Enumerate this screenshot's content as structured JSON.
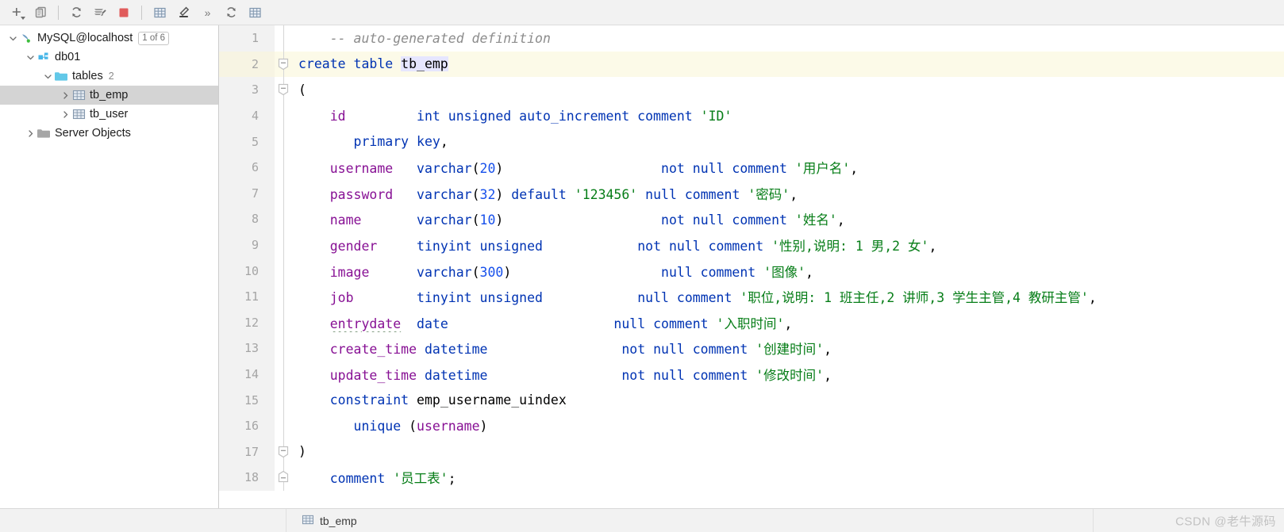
{
  "toolbar": {
    "items": [
      {
        "name": "add-dropdown-icon",
        "title": "New"
      },
      {
        "name": "copy-icon",
        "title": "Duplicate"
      },
      {
        "name": "separator-1",
        "title": ""
      },
      {
        "name": "refresh-icon",
        "title": "Refresh"
      },
      {
        "name": "run-script-icon",
        "title": "Run Script"
      },
      {
        "name": "stop-icon",
        "title": "Stop"
      },
      {
        "name": "separator-2",
        "title": ""
      },
      {
        "name": "table-grid-icon",
        "title": "Data"
      },
      {
        "name": "edit-pencil-icon",
        "title": "Modify"
      },
      {
        "name": "chevron-double-right-icon",
        "title": "More",
        "glyph": "»"
      },
      {
        "name": "refresh-2-icon",
        "title": "Refresh"
      },
      {
        "name": "table-grid-2-icon",
        "title": "Table"
      }
    ]
  },
  "sidebar": {
    "tree": [
      {
        "label": "MySQL@localhost",
        "icon": "dolphin-icon",
        "indent": 0,
        "expanded": true,
        "selected": false,
        "badge": "1 of 6",
        "count": ""
      },
      {
        "label": "db01",
        "icon": "database-icon",
        "indent": 1,
        "expanded": true,
        "selected": false,
        "badge": "",
        "count": ""
      },
      {
        "label": "tables",
        "icon": "folder-cyan-icon",
        "indent": 2,
        "expanded": true,
        "selected": false,
        "badge": "",
        "count": "2"
      },
      {
        "label": "tb_emp",
        "icon": "table-icon",
        "indent": 3,
        "expanded": false,
        "selected": true,
        "badge": "",
        "count": ""
      },
      {
        "label": "tb_user",
        "icon": "table-icon",
        "indent": 3,
        "expanded": false,
        "selected": false,
        "badge": "",
        "count": ""
      },
      {
        "label": "Server Objects",
        "icon": "folder-gray-icon",
        "indent": 1,
        "expanded": false,
        "selected": false,
        "badge": "",
        "count": ""
      }
    ]
  },
  "editor": {
    "highlighted_line": 2,
    "lines": [
      {
        "n": "1",
        "fold": "",
        "tokens": [
          {
            "t": "    ",
            "c": "punct"
          },
          {
            "t": "-- auto-generated definition",
            "c": "cmt"
          }
        ]
      },
      {
        "n": "2",
        "fold": "minus",
        "tokens": [
          {
            "t": "create table ",
            "c": "kw"
          },
          {
            "t": "tb_emp",
            "c": "idhl"
          }
        ]
      },
      {
        "n": "3",
        "fold": "minus",
        "tokens": [
          {
            "t": "(",
            "c": "punct"
          }
        ]
      },
      {
        "n": "4",
        "fold": "",
        "tokens": [
          {
            "t": "    ",
            "c": "punct"
          },
          {
            "t": "id         ",
            "c": "col"
          },
          {
            "t": "int unsigned auto_increment comment ",
            "c": "kw"
          },
          {
            "t": "'ID'",
            "c": "str"
          }
        ]
      },
      {
        "n": "5",
        "fold": "",
        "tokens": [
          {
            "t": "       ",
            "c": "punct"
          },
          {
            "t": "primary key",
            "c": "kw"
          },
          {
            "t": ",",
            "c": "punct"
          }
        ]
      },
      {
        "n": "6",
        "fold": "",
        "tokens": [
          {
            "t": "    ",
            "c": "punct"
          },
          {
            "t": "username",
            "c": "col"
          },
          {
            "t": "   ",
            "c": "punct"
          },
          {
            "t": "varchar",
            "c": "kw"
          },
          {
            "t": "(",
            "c": "punct"
          },
          {
            "t": "20",
            "c": "num"
          },
          {
            "t": ")",
            "c": "punct"
          },
          {
            "t": "                    ",
            "c": "punct"
          },
          {
            "t": "not null comment ",
            "c": "kw"
          },
          {
            "t": "'用户名'",
            "c": "str"
          },
          {
            "t": ",",
            "c": "punct"
          }
        ]
      },
      {
        "n": "7",
        "fold": "",
        "tokens": [
          {
            "t": "    ",
            "c": "punct"
          },
          {
            "t": "password",
            "c": "col"
          },
          {
            "t": "   ",
            "c": "punct"
          },
          {
            "t": "varchar",
            "c": "kw"
          },
          {
            "t": "(",
            "c": "punct"
          },
          {
            "t": "32",
            "c": "num"
          },
          {
            "t": ") ",
            "c": "punct"
          },
          {
            "t": "default ",
            "c": "kw"
          },
          {
            "t": "'123456'",
            "c": "str"
          },
          {
            "t": " null comment ",
            "c": "kw"
          },
          {
            "t": "'密码'",
            "c": "str"
          },
          {
            "t": ",",
            "c": "punct"
          }
        ]
      },
      {
        "n": "8",
        "fold": "",
        "tokens": [
          {
            "t": "    ",
            "c": "punct"
          },
          {
            "t": "name",
            "c": "col"
          },
          {
            "t": "       ",
            "c": "punct"
          },
          {
            "t": "varchar",
            "c": "kw"
          },
          {
            "t": "(",
            "c": "punct"
          },
          {
            "t": "10",
            "c": "num"
          },
          {
            "t": ")",
            "c": "punct"
          },
          {
            "t": "                    ",
            "c": "punct"
          },
          {
            "t": "not null comment ",
            "c": "kw"
          },
          {
            "t": "'姓名'",
            "c": "str"
          },
          {
            "t": ",",
            "c": "punct"
          }
        ]
      },
      {
        "n": "9",
        "fold": "",
        "tokens": [
          {
            "t": "    ",
            "c": "punct"
          },
          {
            "t": "gender",
            "c": "col"
          },
          {
            "t": "     ",
            "c": "punct"
          },
          {
            "t": "tinyint unsigned",
            "c": "kw"
          },
          {
            "t": "            ",
            "c": "punct"
          },
          {
            "t": "not null comment ",
            "c": "kw"
          },
          {
            "t": "'性别,说明: 1 男,2 女'",
            "c": "str"
          },
          {
            "t": ",",
            "c": "punct"
          }
        ]
      },
      {
        "n": "10",
        "fold": "",
        "tokens": [
          {
            "t": "    ",
            "c": "punct"
          },
          {
            "t": "image",
            "c": "col"
          },
          {
            "t": "      ",
            "c": "punct"
          },
          {
            "t": "varchar",
            "c": "kw"
          },
          {
            "t": "(",
            "c": "punct"
          },
          {
            "t": "300",
            "c": "num"
          },
          {
            "t": ")",
            "c": "punct"
          },
          {
            "t": "                   ",
            "c": "punct"
          },
          {
            "t": "null comment ",
            "c": "kw"
          },
          {
            "t": "'图像'",
            "c": "str"
          },
          {
            "t": ",",
            "c": "punct"
          }
        ]
      },
      {
        "n": "11",
        "fold": "",
        "tokens": [
          {
            "t": "    ",
            "c": "punct"
          },
          {
            "t": "job",
            "c": "col"
          },
          {
            "t": "        ",
            "c": "punct"
          },
          {
            "t": "tinyint unsigned",
            "c": "kw"
          },
          {
            "t": "            ",
            "c": "punct"
          },
          {
            "t": "null comment ",
            "c": "kw"
          },
          {
            "t": "'职位,说明: 1 班主任,2 讲师,3 学生主管,4 教研主管'",
            "c": "str"
          },
          {
            "t": ",",
            "c": "punct"
          }
        ]
      },
      {
        "n": "12",
        "fold": "",
        "tokens": [
          {
            "t": "    ",
            "c": "punct"
          },
          {
            "t": "entrydate",
            "c": "col squig"
          },
          {
            "t": "  ",
            "c": "punct"
          },
          {
            "t": "date",
            "c": "kw"
          },
          {
            "t": "                     ",
            "c": "punct"
          },
          {
            "t": "null comment ",
            "c": "kw"
          },
          {
            "t": "'入职时间'",
            "c": "str"
          },
          {
            "t": ",",
            "c": "punct"
          }
        ]
      },
      {
        "n": "13",
        "fold": "",
        "tokens": [
          {
            "t": "    ",
            "c": "punct"
          },
          {
            "t": "create_time",
            "c": "col"
          },
          {
            "t": " ",
            "c": "punct"
          },
          {
            "t": "datetime",
            "c": "kw"
          },
          {
            "t": "                 ",
            "c": "punct"
          },
          {
            "t": "not null comment ",
            "c": "kw"
          },
          {
            "t": "'创建时间'",
            "c": "str"
          },
          {
            "t": ",",
            "c": "punct"
          }
        ]
      },
      {
        "n": "14",
        "fold": "",
        "tokens": [
          {
            "t": "    ",
            "c": "punct"
          },
          {
            "t": "update_time",
            "c": "col"
          },
          {
            "t": " ",
            "c": "punct"
          },
          {
            "t": "datetime",
            "c": "kw"
          },
          {
            "t": "                 ",
            "c": "punct"
          },
          {
            "t": "not null comment ",
            "c": "kw"
          },
          {
            "t": "'修改时间'",
            "c": "str"
          },
          {
            "t": ",",
            "c": "punct"
          }
        ]
      },
      {
        "n": "15",
        "fold": "",
        "tokens": [
          {
            "t": "    ",
            "c": "punct"
          },
          {
            "t": "constraint ",
            "c": "kw"
          },
          {
            "t": "emp_username_uindex",
            "c": "id squig"
          }
        ]
      },
      {
        "n": "16",
        "fold": "",
        "tokens": [
          {
            "t": "       ",
            "c": "punct"
          },
          {
            "t": "unique ",
            "c": "kw"
          },
          {
            "t": "(",
            "c": "punct"
          },
          {
            "t": "username",
            "c": "col"
          },
          {
            "t": ")",
            "c": "punct"
          }
        ]
      },
      {
        "n": "17",
        "fold": "minus",
        "tokens": [
          {
            "t": ")",
            "c": "punct"
          }
        ]
      },
      {
        "n": "18",
        "fold": "minus-end",
        "tokens": [
          {
            "t": "    ",
            "c": "punct"
          },
          {
            "t": "comment ",
            "c": "kw"
          },
          {
            "t": "'员工表'",
            "c": "str"
          },
          {
            "t": ";",
            "c": "punct"
          }
        ]
      }
    ]
  },
  "statusbar": {
    "table_name": "tb_emp",
    "table_icon": "table-icon",
    "watermark": "CSDN @老牛源码"
  },
  "colors": {
    "keyword": "#0033b3",
    "column": "#871094",
    "string": "#067d17",
    "number": "#1750eb",
    "comment": "#8c8c8c",
    "selection": "#d4d4d4",
    "line_highlight": "#fcfae8",
    "stop_red": "#e05c5c"
  }
}
